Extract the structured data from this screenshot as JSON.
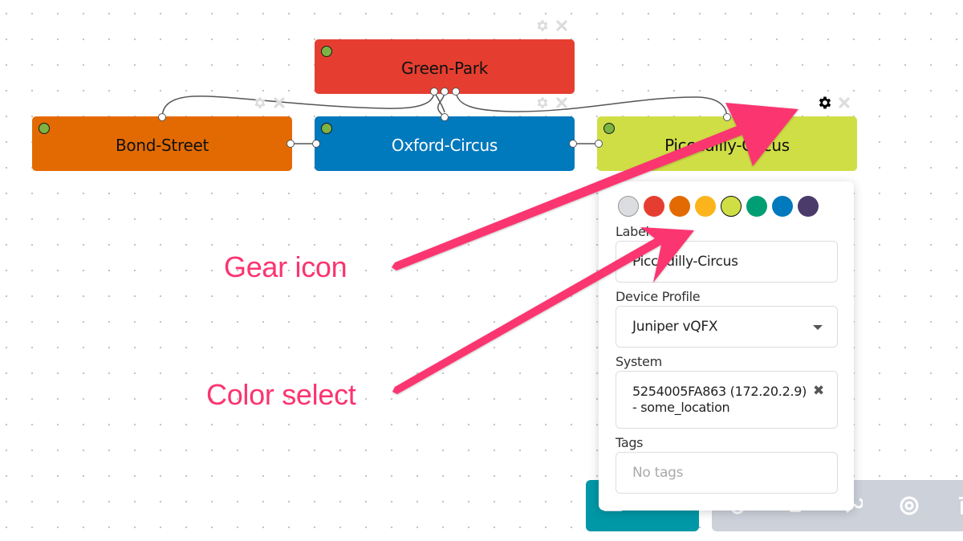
{
  "canvas": {
    "nodes": [
      {
        "id": "green-park",
        "label": "Green-Park",
        "color": "#e53e30",
        "text_color": "#111111",
        "status_color": "#7cb342"
      },
      {
        "id": "bond-street",
        "label": "Bond-Street",
        "color": "#e36a02",
        "text_color": "#111111",
        "status_color": "#7cb342"
      },
      {
        "id": "oxford-circus",
        "label": "Oxford-Circus",
        "color": "#0079bd",
        "text_color": "#ffffff",
        "status_color": "#7cb342"
      },
      {
        "id": "piccadilly-circus",
        "label": "Piccadilly-Circus",
        "color": "#d0de46",
        "text_color": "#111111",
        "status_color": "#7cb342"
      }
    ],
    "edges": [
      {
        "from": "green-park",
        "to": "bond-street"
      },
      {
        "from": "green-park",
        "to": "oxford-circus"
      },
      {
        "from": "green-park",
        "to": "piccadilly-circus"
      },
      {
        "from": "bond-street",
        "to": "oxford-circus"
      },
      {
        "from": "oxford-circus",
        "to": "piccadilly-circus"
      }
    ]
  },
  "popup": {
    "colors": [
      {
        "name": "grey",
        "hex": "#dcdde0",
        "selected": false
      },
      {
        "name": "red",
        "hex": "#e53e30",
        "selected": false
      },
      {
        "name": "orange",
        "hex": "#e36a02",
        "selected": false
      },
      {
        "name": "yellow",
        "hex": "#fbb41c",
        "selected": false
      },
      {
        "name": "lime",
        "hex": "#d0de46",
        "selected": true
      },
      {
        "name": "green",
        "hex": "#009e73",
        "selected": false
      },
      {
        "name": "blue",
        "hex": "#0079bd",
        "selected": false
      },
      {
        "name": "purple",
        "hex": "#4a3b6b",
        "selected": false
      }
    ],
    "label_title": "Label",
    "label_value": "Piccadilly-Circus",
    "device_profile_title": "Device Profile",
    "device_profile_value": "Juniper vQFX",
    "system_title": "System",
    "system_value": "5254005FA863 (172.20.2.9) - some_location",
    "tags_title": "Tags",
    "tags_placeholder": "No tags"
  },
  "toolbar": {
    "primary_color": "#0097a7",
    "secondary_color": "#cdd1da"
  },
  "annotations": {
    "gear": "Gear icon",
    "color": "Color select",
    "color_hex": "#fb3470"
  }
}
